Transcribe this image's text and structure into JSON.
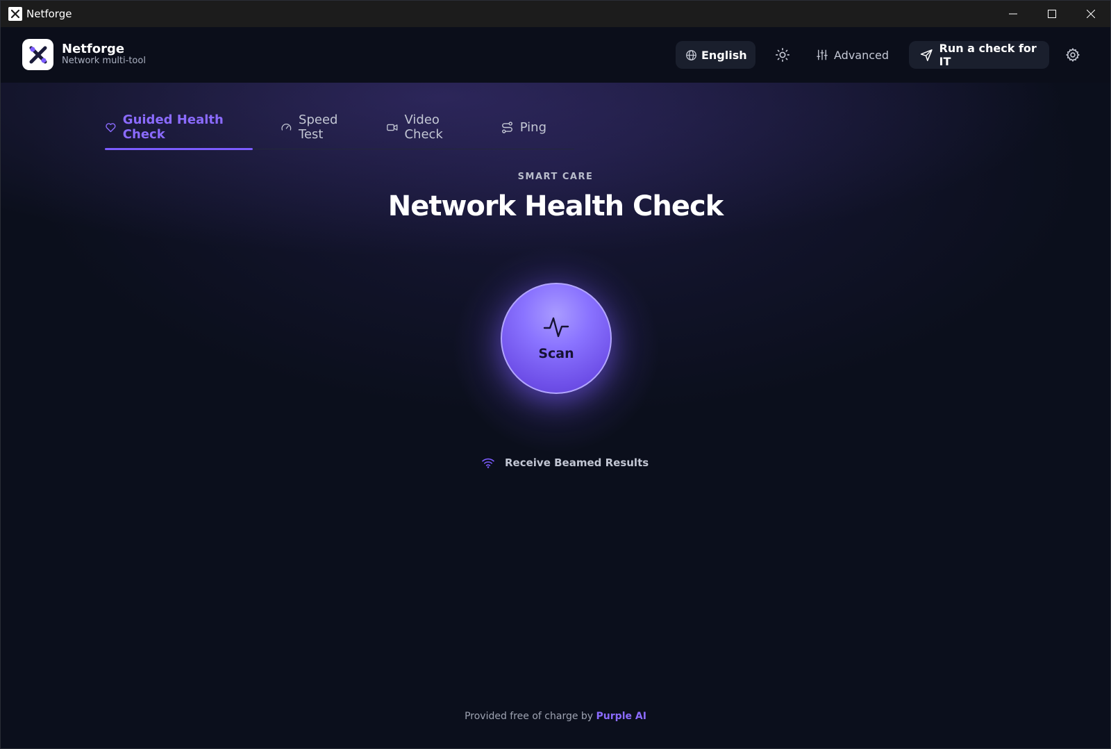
{
  "window": {
    "title": "Netforge"
  },
  "header": {
    "brand_name": "Netforge",
    "brand_sub": "Network multi-tool",
    "language_label": "English",
    "advanced_label": "Advanced",
    "run_check_label": "Run a check for IT"
  },
  "tabs": [
    {
      "label": "Guided Health Check",
      "icon": "heart-icon",
      "active": true
    },
    {
      "label": "Speed Test",
      "icon": "gauge-icon",
      "active": false
    },
    {
      "label": "Video Check",
      "icon": "video-camera-icon",
      "active": false
    },
    {
      "label": "Ping",
      "icon": "route-icon",
      "active": false
    }
  ],
  "main": {
    "eyebrow": "SMART CARE",
    "title": "Network Health Check",
    "scan_label": "Scan",
    "beamed_label": "Receive Beamed Results"
  },
  "footer": {
    "text": "Provided free of charge by",
    "brand": "Purple AI"
  },
  "colors": {
    "accent": "#7c5cff",
    "background": "#0b0f1c",
    "titlebar": "#1c1c1c"
  }
}
